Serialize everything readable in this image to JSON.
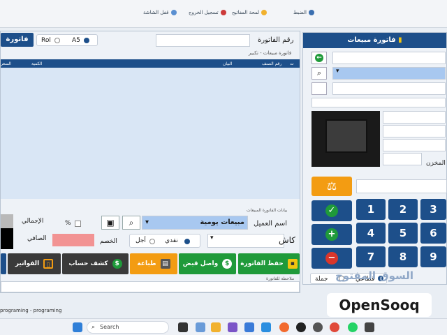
{
  "topbar": {
    "item1": "الضبط",
    "item2": "لمحة المفاتيح",
    "item3": "تسجيل الخروج",
    "item4": "قفل الشاشة"
  },
  "invoice": {
    "invoice_button": "فاتورة",
    "paper_size_a5": "A5",
    "paper_size_roll": "Rol",
    "number_label": "رقم الفاتورة",
    "number_value": "",
    "grid_title": "فاتورة مبيعات - تكبير",
    "columns": [
      "ت",
      "رقم الصنف",
      "البيان",
      "الكمية",
      "السعر"
    ],
    "rows": []
  },
  "details": {
    "section_title": "بيانات الفاتورة المبيعات",
    "customer_label": "اسم العميل",
    "customer_value": "مبيعات يومية",
    "cash_label": "كاش",
    "payment_cash": "نقدي",
    "payment_credit": "أجل",
    "discount_label": "الخصم",
    "percent_label": "%",
    "total_label": "الإجمالي",
    "net_label": "الصافي"
  },
  "actions": {
    "save_invoice": "حفظ الفاتورة",
    "receipt": "واصل قبض",
    "print": "طباعة",
    "statement": "كشف حساب",
    "invoices": "الفواتير"
  },
  "notes_label": "ملاحظة للفاتورة",
  "status_text": "programing - programing",
  "side": {
    "header": "فاتورة مبيعات",
    "warehouse_label": "المخزن",
    "sale_type_retail": "قطاعي",
    "sale_type_wholesale": "جملة",
    "keypad": [
      "1",
      "2",
      "3",
      "4",
      "5",
      "6",
      "7",
      "8",
      "9"
    ]
  },
  "taskbar": {
    "search_placeholder": "Search"
  },
  "watermark": {
    "text": "OpenSooq",
    "arabic": "السوق المفتوح"
  },
  "colors": {
    "primary": "#1d4f8a",
    "accent_green": "#1f9a3a",
    "accent_orange": "#f39c12",
    "dark": "#3a3a3a",
    "red": "#d9362b",
    "pink": "#f29393"
  }
}
